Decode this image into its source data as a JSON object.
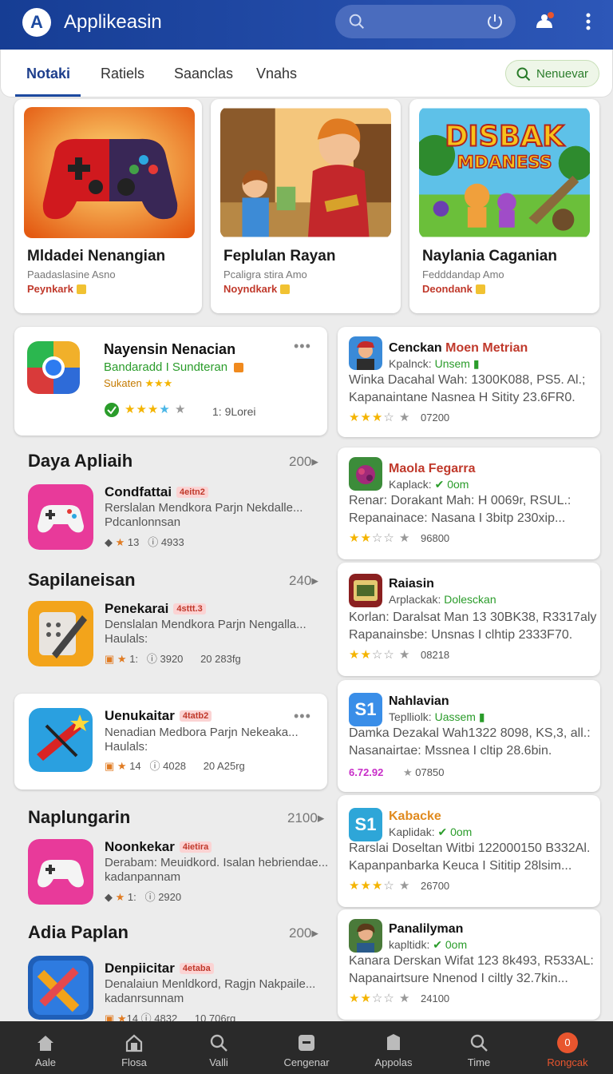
{
  "app": {
    "title": "Applikeasin",
    "logo_letter": "A"
  },
  "header_icons": [
    "search-icon",
    "power-icon",
    "notification-icon",
    "more-icon"
  ],
  "tabs": [
    {
      "label": "Notaki",
      "active": true
    },
    {
      "label": "Ratiels",
      "active": false
    },
    {
      "label": "Saanclas",
      "active": false
    },
    {
      "label": "Vnahs",
      "active": false
    }
  ],
  "new_button": {
    "label": "Nenuevar"
  },
  "featured": [
    {
      "title": "Mldadei Nenangian",
      "subtitle": "Paadaslasine Asno",
      "tag": "Peynkark"
    },
    {
      "title": "Feplulan Rayan",
      "subtitle": "Pcaligra stira Amo",
      "tag": "Noyndkark"
    },
    {
      "title": "Naylania Caganian",
      "subtitle": "Fedddandap Amo",
      "tag": "Deondank",
      "art_text_1": "DISBAK",
      "art_text_2": "MDANESS"
    }
  ],
  "spotlight": {
    "title": "Nayensin Nenacian",
    "line1": "Bandaradd I Sundteran",
    "line2": "Sukaten",
    "rating_text": "1: 9Lorei"
  },
  "left_sections": [
    {
      "title": "Daya Apliaih",
      "count": "200",
      "item": {
        "name": "Condfattai",
        "badge": "4eitn2",
        "desc": "Rerslalan Mendkora Parjn Nekdalle...",
        "desc2": "Pdcanlonnsan",
        "m1": "13",
        "m2": "4933",
        "m3": ""
      }
    },
    {
      "title": "Sapilaneisan",
      "count": "240",
      "item": {
        "name": "Penekarai",
        "badge": "4sttt.3",
        "desc": "Denslalan Mendkora Parjn Nengalla...",
        "desc2": "Haulals:",
        "m1": "1:",
        "m2": "3920",
        "m3": "20 283fg"
      }
    },
    {
      "title": "",
      "count": "",
      "item": {
        "name": "Uenukaitar",
        "badge": "4tatb2",
        "desc": "Nenadian Medbora Parjn Nekeaka...",
        "desc2": "Haulals:",
        "m1": "14",
        "m2": "4028",
        "m3": "20 A25rg"
      }
    },
    {
      "title": "Naplungarin",
      "count": "2100",
      "item": {
        "name": "Noonkekar",
        "badge": "4ietira",
        "desc": "Derabam: Meuidkord. Isalan hebriendae...",
        "desc2": "kadanpannam",
        "m1": "1:",
        "m2": "2920",
        "m3": ""
      }
    },
    {
      "title": "Adia Paplan",
      "count": "200",
      "item": {
        "name": "Denpiicitar",
        "badge": "4etaba",
        "desc": "Denalaiun Menldkord, Ragjn Nakpaile...",
        "desc2": "kadanrsunnam",
        "m1": "14",
        "m2": "4832",
        "m3": "10 706rg"
      }
    }
  ],
  "right_list": [
    {
      "title": "Cenckan",
      "title_accent": "Moen Metrian",
      "sub": "Kpalnck:",
      "sub_accent": "Unsem",
      "l1": "Winka Dacahal Wah: 1300K088, PS5. Al.;",
      "l2": "Kapanaintane Nasnea H Sitity 23.6FR0.",
      "count": "07200",
      "stars": 3
    },
    {
      "title": "Maola Fegarra",
      "title_accent": "",
      "sub": "Kaplack:",
      "sub_accent": "0om",
      "l1": "Renar: Dorakant Mah: H 0069r, RSUL.:",
      "l2": "Repanainace: Nasana I 3bitp 230xip...",
      "count": "96800",
      "stars": 2
    },
    {
      "title": "Raiasin",
      "title_accent": "",
      "sub": "Arplackak:",
      "sub_accent": "Dolesckan",
      "l1": "Korlan: Daralsat Man 13 30BK38, R3317aly",
      "l2": "Rapanainsbe: Unsnas I clhtip 2333F70.",
      "count": "08218",
      "stars": 2
    },
    {
      "title": "Nahlavian",
      "title_accent": "",
      "sub": "Teplliolk:",
      "sub_accent": "Uassem",
      "l1": "Damka Dezakal Wah1322 8098, KS,3, all.:",
      "l2": "Nasanairtae: Mssnea I cltip 28.6bin.",
      "count": "07850",
      "rating_label": "6.72.92",
      "stars": 0
    },
    {
      "title": "Kabacke",
      "title_accent": "",
      "sub": "Kaplidak:",
      "sub_accent": "0om",
      "l1": "Rarslai Doseltan Witbi 122000150 B332Al.",
      "l2": "Kapanpanbarka Keuca I Sititip 28lsim...",
      "count": "26700",
      "stars": 3
    },
    {
      "title": "Panalilyman",
      "title_accent": "",
      "sub": "kapltidk:",
      "sub_accent": "0om",
      "l1": "Kanara Derskan Wifat 123 8k493, R533AL:",
      "l2": "Napanairtsure Nnenod I ciltly 32.7kin...",
      "count": "24100",
      "stars": 2
    }
  ],
  "bottom_nav": [
    {
      "label": "Aale",
      "icon": "home-icon"
    },
    {
      "label": "Flosa",
      "icon": "store-icon"
    },
    {
      "label": "Valli",
      "icon": "search-icon"
    },
    {
      "label": "Cengenar",
      "icon": "category-icon"
    },
    {
      "label": "Appolas",
      "icon": "apps-icon"
    },
    {
      "label": "Time",
      "icon": "search-icon"
    },
    {
      "label": "Rongcak",
      "icon": "profile-icon",
      "badge": "0",
      "active": true
    }
  ],
  "colors": {
    "primary": "#1d4aa0",
    "accent_red": "#c0392b",
    "green": "#2a9c2a",
    "star": "#f4b400"
  }
}
